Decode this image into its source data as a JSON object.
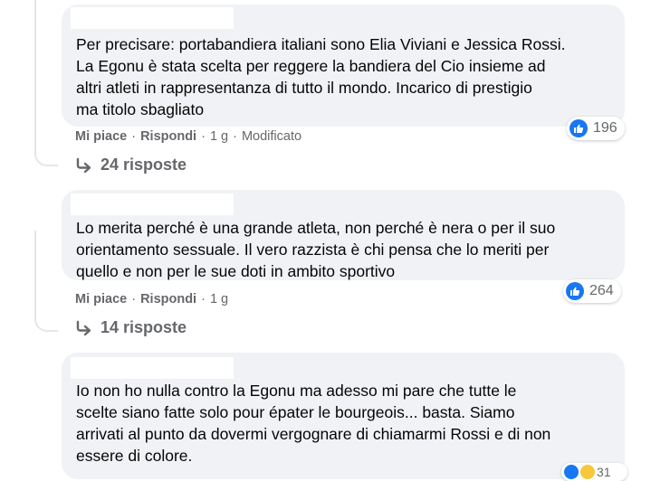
{
  "comments": [
    {
      "text": "Per precisare: portabandiera italiani sono Elia Viviani e Jessica Rossi.\nLa Egonu è stata scelta per reggere la bandiera del Cio insieme ad\naltri atleti in rappresentanza di tutto il mondo. Incarico di prestigio\nma titolo sbagliato",
      "reaction_count": "196",
      "like": "Mi piace",
      "reply": "Rispondi",
      "time": "1 g",
      "edited": "Modificato",
      "replies_label": "24 risposte"
    },
    {
      "text": "Lo merita perché è una grande atleta, non perché è nera o per il suo\norientamento sessuale. Il vero razzista è chi pensa che lo meriti per\nquello e non per le sue doti in ambito sportivo",
      "reaction_count": "264",
      "like": "Mi piace",
      "reply": "Rispondi",
      "time": "1 g",
      "replies_label": "14 risposte"
    },
    {
      "text": "Io non ho nulla contro la Egonu ma adesso mi pare che tutte le\nscelte siano fatte solo pour épater le bourgeois... basta. Siamo\narrivati al punto da dovermi vergognare di chiamarmi Rossi e di non\nessere di colore.",
      "reaction_count": "31"
    }
  ],
  "separator": "·",
  "colors": {
    "bubble": "#f0f2f5",
    "meta": "#65676b",
    "like_blue": "#1877f2"
  },
  "icons": [
    "like-icon",
    "reply-arrow-icon",
    "haha-icon"
  ]
}
